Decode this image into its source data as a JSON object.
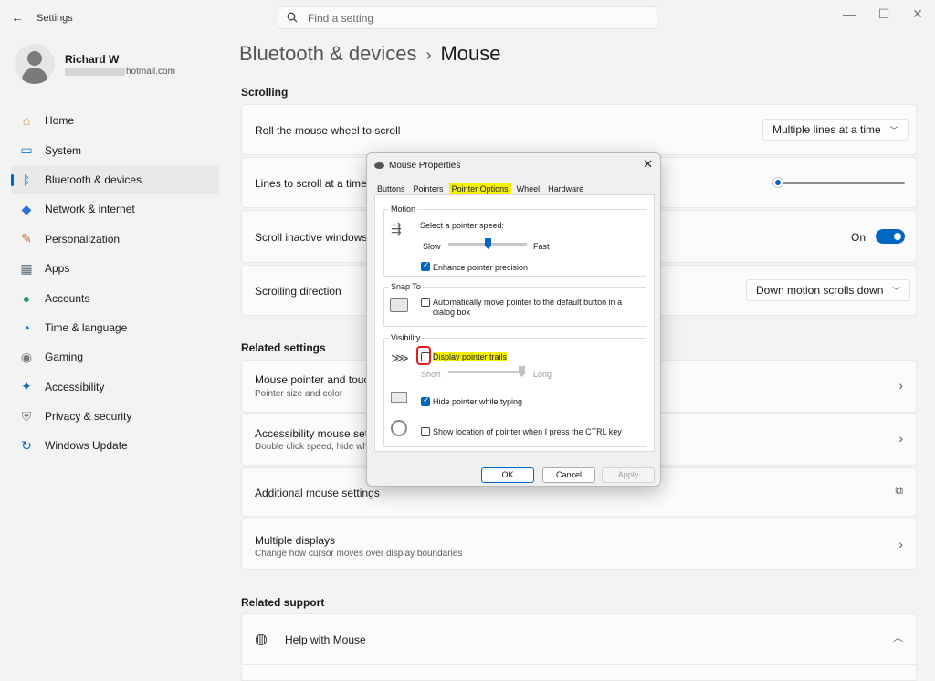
{
  "window": {
    "title": "Settings",
    "minimize": "—",
    "maximize": "☐",
    "close": "✕"
  },
  "search": {
    "placeholder": "Find a setting"
  },
  "profile": {
    "name": "Richard W",
    "email_suffix": "hotmail.com"
  },
  "sidebar": {
    "items": [
      {
        "label": "Home",
        "icon": "home-icon",
        "color": "#d08a3a"
      },
      {
        "label": "System",
        "icon": "monitor-icon",
        "color": "#0078d4"
      },
      {
        "label": "Bluetooth & devices",
        "icon": "bluetooth-icon",
        "color": "#0078d4",
        "active": true
      },
      {
        "label": "Network & internet",
        "icon": "wifi-icon",
        "color": "#2e74d8"
      },
      {
        "label": "Personalization",
        "icon": "brush-icon",
        "color": "#c86a2a"
      },
      {
        "label": "Apps",
        "icon": "apps-icon",
        "color": "#5a6a7a"
      },
      {
        "label": "Accounts",
        "icon": "person-icon",
        "color": "#18a07a"
      },
      {
        "label": "Time & language",
        "icon": "globe-clock-icon",
        "color": "#2a7ac8"
      },
      {
        "label": "Gaming",
        "icon": "gamepad-icon",
        "color": "#7a7a7a"
      },
      {
        "label": "Accessibility",
        "icon": "accessibility-icon",
        "color": "#0a6ab8"
      },
      {
        "label": "Privacy & security",
        "icon": "shield-icon",
        "color": "#7a7a7a"
      },
      {
        "label": "Windows Update",
        "icon": "update-icon",
        "color": "#0a6ac8"
      }
    ]
  },
  "breadcrumb": {
    "parent": "Bluetooth & devices",
    "separator": "›",
    "current": "Mouse"
  },
  "scrolling": {
    "heading": "Scrolling",
    "roll_wheel": {
      "label": "Roll the mouse wheel to scroll",
      "value": "Multiple lines at a time"
    },
    "lines": {
      "label": "Lines to scroll at a time",
      "slider_fraction": 0.05
    },
    "inactive": {
      "label": "Scroll inactive windows w",
      "state": "On"
    },
    "direction": {
      "label": "Scrolling direction",
      "value": "Down motion scrolls down"
    }
  },
  "related": {
    "heading": "Related settings",
    "pointer": {
      "title": "Mouse pointer and touch",
      "sub": "Pointer size and color"
    },
    "accessibility": {
      "title": "Accessibility mouse settin",
      "sub": "Double click speed, hide wh"
    },
    "additional": {
      "title": "Additional mouse settings"
    },
    "displays": {
      "title": "Multiple displays",
      "sub": "Change how cursor moves over display boundaries"
    }
  },
  "support": {
    "heading": "Related support",
    "help": "Help with Mouse"
  },
  "dialog": {
    "title": "Mouse Properties",
    "close": "✕",
    "tabs": [
      "Buttons",
      "Pointers",
      "Pointer Options",
      "Wheel",
      "Hardware"
    ],
    "active_tab": "Pointer Options",
    "motion": {
      "label": "Motion",
      "prompt": "Select a pointer speed:",
      "slow": "Slow",
      "fast": "Fast",
      "speed_fraction": 0.5,
      "precision": "Enhance pointer precision",
      "precision_checked": true
    },
    "snap": {
      "label": "Snap To",
      "text1": "Automatically move pointer to the default button in a",
      "text2": "dialog box",
      "checked": false
    },
    "visibility": {
      "label": "Visibility",
      "trails": "Display pointer trails",
      "trails_checked": false,
      "short": "Short",
      "long": "Long",
      "trail_fraction": 1.0,
      "hide": "Hide pointer while typing",
      "hide_checked": true,
      "ctrl": "Show location of pointer when I press the CTRL key",
      "ctrl_checked": false
    },
    "buttons": {
      "ok": "OK",
      "cancel": "Cancel",
      "apply": "Apply"
    }
  }
}
